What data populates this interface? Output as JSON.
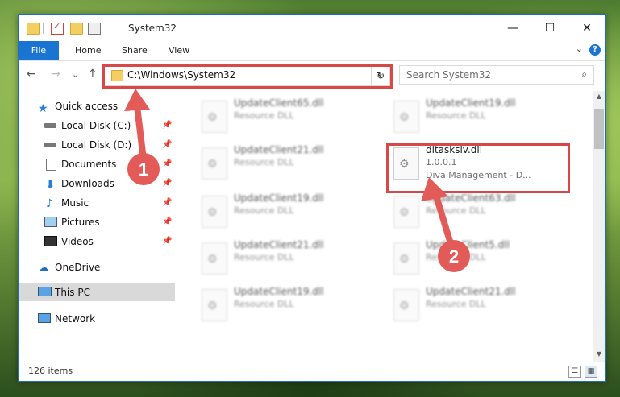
{
  "window": {
    "title": "System32"
  },
  "ribbon": {
    "tabs": [
      "File",
      "Home",
      "Share",
      "View"
    ],
    "help": "?"
  },
  "window_controls": {
    "minimize": "—",
    "maximize": "☐",
    "close": "✕"
  },
  "navigation": {
    "back": "←",
    "forward": "→",
    "recent": "⌄",
    "up": "↑"
  },
  "address": {
    "path": "C:\\Windows\\System32",
    "refresh": "↻",
    "dropdown": "⌄"
  },
  "search": {
    "placeholder": "Search System32",
    "icon": "⌕"
  },
  "nav_pane": {
    "quick_access": "Quick access",
    "items": [
      "Local Disk (C:)",
      "Local Disk (D:)",
      "Documents",
      "Downloads",
      "Music",
      "Pictures",
      "Videos"
    ],
    "onedrive": "OneDrive",
    "this_pc": "This PC",
    "network": "Network"
  },
  "files": [
    {
      "name": "UpdateClient65.dll",
      "type": "Resource DLL"
    },
    {
      "name": "UpdateClient19.dll",
      "type": "Resource DLL"
    },
    {
      "name": "UpdateClient21.dll",
      "type": "Resource DLL"
    },
    {
      "name": "ditaskslv.dll",
      "type": "1.0.0.1",
      "desc": "Diva Management - D..."
    },
    {
      "name": "UpdateClient19.dll",
      "type": "Resource DLL"
    },
    {
      "name": "UpdateClient63.dll",
      "type": "Resource DLL"
    },
    {
      "name": "UpdateClient21.dll",
      "type": "Resource DLL"
    },
    {
      "name": "UpdateClient5.dll",
      "type": "Resource DLL"
    },
    {
      "name": "UpdateClient19.dll",
      "type": "Resource DLL"
    },
    {
      "name": "UpdateClient21.dll",
      "type": "Resource DLL"
    }
  ],
  "status": {
    "count": "126 items"
  },
  "annotations": {
    "badge1": "1",
    "badge2": "2",
    "color": "#e35b58"
  }
}
